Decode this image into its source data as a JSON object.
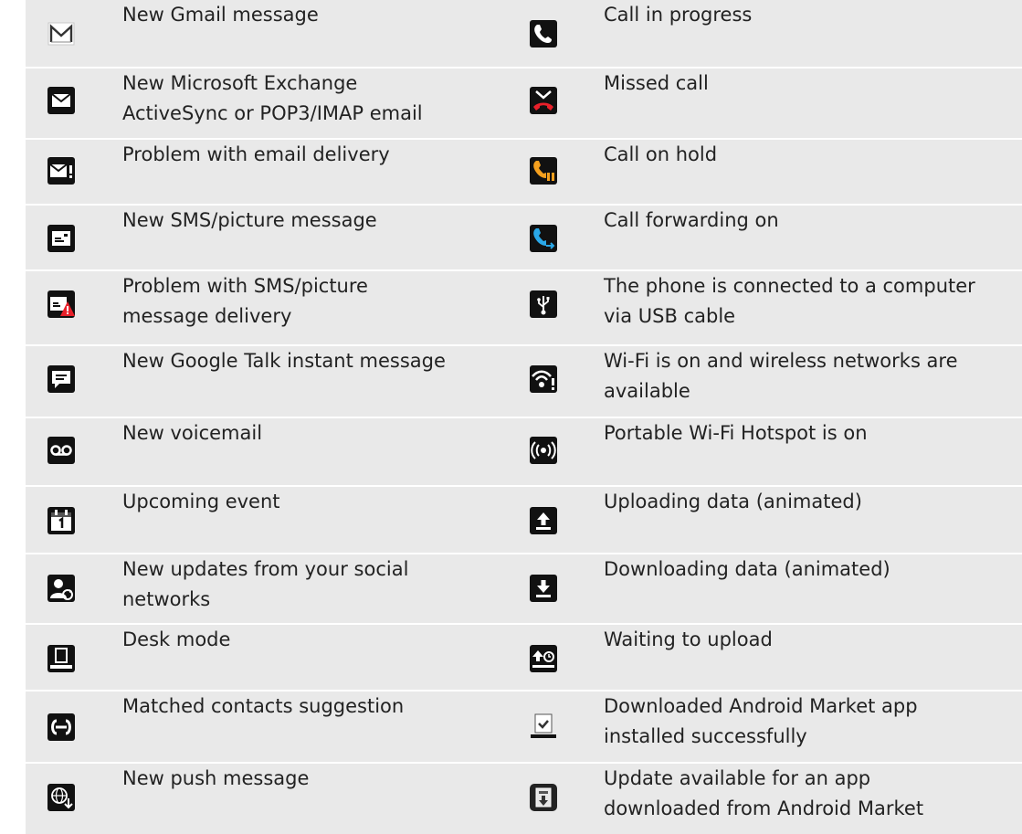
{
  "colors": {
    "row_background": "#e9e9e9",
    "separator": "#ffffff",
    "text": "#222222",
    "icon_background": "#111111",
    "missed_call_red": "#e8202a",
    "hold_orange": "#f5a01e",
    "forward_blue": "#2aa8e8"
  },
  "rows": [
    {
      "left": {
        "icon": "gmail-icon",
        "lines": [
          "New Gmail message"
        ]
      },
      "right": {
        "icon": "call-in-progress-icon",
        "lines": [
          "Call in progress"
        ]
      }
    },
    {
      "left": {
        "icon": "email-icon",
        "lines": [
          "New Microsoft Exchange",
          "ActiveSync or POP3/IMAP email"
        ]
      },
      "right": {
        "icon": "missed-call-icon",
        "lines": [
          "Missed call"
        ]
      }
    },
    {
      "left": {
        "icon": "email-problem-icon",
        "lines": [
          "Problem with email delivery"
        ]
      },
      "right": {
        "icon": "call-on-hold-icon",
        "lines": [
          "Call on hold"
        ]
      }
    },
    {
      "left": {
        "icon": "sms-icon",
        "lines": [
          "New SMS/picture message"
        ]
      },
      "right": {
        "icon": "call-forwarding-icon",
        "lines": [
          "Call forwarding on"
        ]
      }
    },
    {
      "left": {
        "icon": "sms-problem-icon",
        "lines": [
          "Problem with SMS/picture",
          "message delivery"
        ]
      },
      "right": {
        "icon": "usb-icon",
        "lines": [
          "The phone is connected to a computer",
          "via USB cable"
        ]
      }
    },
    {
      "left": {
        "icon": "google-talk-icon",
        "lines": [
          "New Google Talk instant message"
        ]
      },
      "right": {
        "icon": "wifi-available-icon",
        "lines": [
          "Wi-Fi is on and wireless networks are",
          "available"
        ]
      }
    },
    {
      "left": {
        "icon": "voicemail-icon",
        "lines": [
          "New voicemail"
        ]
      },
      "right": {
        "icon": "hotspot-icon",
        "lines": [
          "Portable Wi-Fi Hotspot is on"
        ]
      }
    },
    {
      "left": {
        "icon": "calendar-icon",
        "lines": [
          "Upcoming event"
        ]
      },
      "right": {
        "icon": "upload-icon",
        "lines": [
          "Uploading data (animated)"
        ]
      }
    },
    {
      "left": {
        "icon": "social-update-icon",
        "lines": [
          "New updates from your social",
          "networks"
        ]
      },
      "right": {
        "icon": "download-icon",
        "lines": [
          "Downloading data (animated)"
        ]
      }
    },
    {
      "left": {
        "icon": "desk-mode-icon",
        "lines": [
          "Desk mode"
        ]
      },
      "right": {
        "icon": "waiting-upload-icon",
        "lines": [
          "Waiting to upload"
        ]
      }
    },
    {
      "left": {
        "icon": "matched-contacts-icon",
        "lines": [
          "Matched contacts suggestion"
        ]
      },
      "right": {
        "icon": "app-installed-icon",
        "lines": [
          "Downloaded Android Market app",
          "installed successfully"
        ]
      }
    },
    {
      "left": {
        "icon": "push-message-icon",
        "lines": [
          "New push message"
        ]
      },
      "right": {
        "icon": "app-update-icon",
        "lines": [
          "Update available for an app",
          "downloaded from Android Market"
        ]
      }
    }
  ]
}
